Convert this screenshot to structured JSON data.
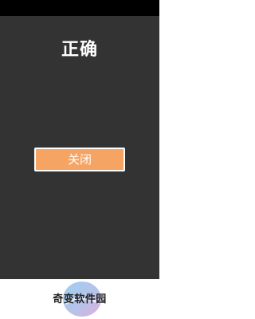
{
  "dialog": {
    "title": "正确",
    "close_label": "关闭"
  },
  "watermark": {
    "text": "奇变软件园"
  },
  "colors": {
    "status_bar": "#000000",
    "dialog_background": "#333333",
    "button_fill": "#f5a464",
    "button_border": "#ffffff",
    "title_text": "#ffffff",
    "page_background": "#ffffff"
  }
}
